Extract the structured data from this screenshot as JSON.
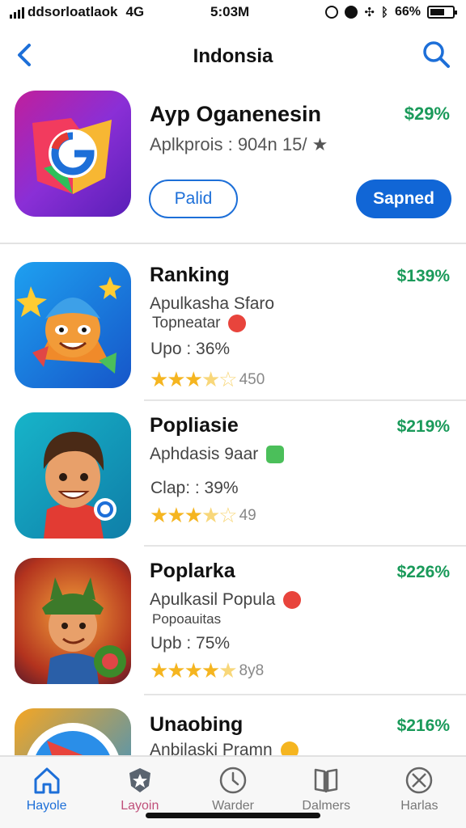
{
  "status_bar": {
    "carrier": "ddsorloatlaok",
    "network": "4G",
    "time": "5:03M",
    "battery": "66%",
    "battery_level": 0.66
  },
  "nav": {
    "title": "Indonsia",
    "back_icon": "chevron-left-icon",
    "search_icon": "search-icon"
  },
  "featured": {
    "title": "Ayp Oganenesin",
    "subtitle": "Aplkprois : 904n 15/ ★",
    "price": "$29%",
    "outline_button": "Palid",
    "solid_button": "Sapned"
  },
  "apps": [
    {
      "title": "Ranking",
      "price": "$139%",
      "subtitle": "Apulkasha Sfaro",
      "subtitle2": "Topneatar",
      "stat": "Upo : 36%",
      "rating": 3.5,
      "rating_count": "450"
    },
    {
      "title": "Popliasie",
      "price": "$219%",
      "subtitle": "Aphdasis 9aar",
      "subtitle2": "",
      "stat": "Clap: : 39%",
      "rating": 3.5,
      "rating_count": "49"
    },
    {
      "title": "Poplarka",
      "price": "$226%",
      "subtitle": "Apulkasil Popula",
      "subtitle2": "Popoauitas",
      "stat": "Upb : 75%",
      "rating": 4,
      "rating_count": "8y8"
    },
    {
      "title": "Unaobing",
      "price": "$216%",
      "subtitle": "Anbilaski Pramn",
      "subtitle2": "",
      "stat": "",
      "rating": 0,
      "rating_count": ""
    }
  ],
  "tabs": [
    {
      "label": "Hayole",
      "icon": "home-icon"
    },
    {
      "label": "Layoin",
      "icon": "star-shield-icon"
    },
    {
      "label": "Warder",
      "icon": "compass-icon"
    },
    {
      "label": "Dalmers",
      "icon": "book-icon"
    },
    {
      "label": "Harlas",
      "icon": "circle-x-icon"
    }
  ],
  "colors": {
    "accent": "#1166d6",
    "price_green": "#1a9a5a",
    "star": "#f5b520"
  }
}
